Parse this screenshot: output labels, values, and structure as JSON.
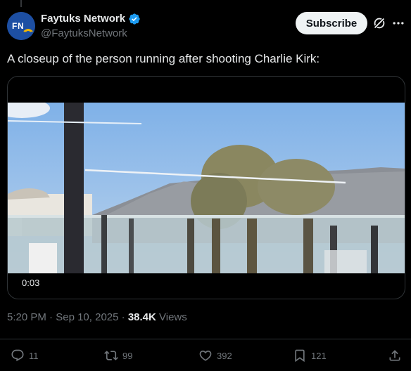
{
  "post": {
    "author": {
      "display_name": "Faytuks Network",
      "handle": "@FaytuksNetwork",
      "verified": true,
      "avatar_icon": "faytuks-logo"
    },
    "subscribe_label": "Subscribe",
    "text": "A closeup of the person running after shooting Charlie Kirk:",
    "media": {
      "type": "video",
      "time": "0:03"
    },
    "time": "5:20 PM",
    "separator": "·",
    "date": "Sep 10, 2025",
    "views_count": "38.4K",
    "views_label": "Views",
    "stats": {
      "replies": "11",
      "reposts": "99",
      "likes": "392",
      "bookmarks": "121"
    }
  },
  "colors": {
    "background": "#000000",
    "text": "#e7e9ea",
    "secondary_text": "#71767b",
    "verified_badge": "#1d9bf0",
    "subscribe_bg": "#eff3f4",
    "border": "#2f3336"
  },
  "icons": [
    "verified-icon",
    "grok-icon",
    "more-icon",
    "reply-icon",
    "repost-icon",
    "like-icon",
    "bookmark-icon",
    "share-icon"
  ]
}
